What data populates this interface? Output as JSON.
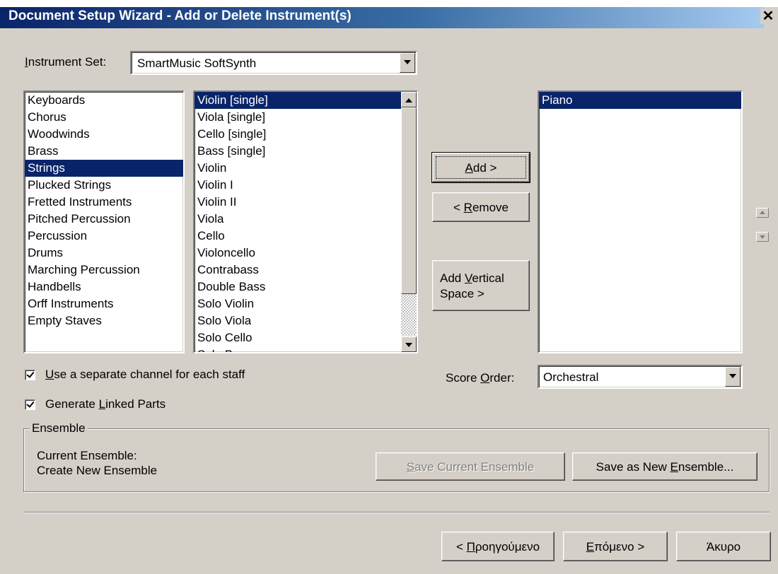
{
  "window": {
    "title": "Document Setup Wizard - Add or Delete Instrument(s)",
    "close_glyph": "✕"
  },
  "instrument_set": {
    "label_u": "I",
    "label_rest": "nstrument Set:",
    "value": "SmartMusic SoftSynth"
  },
  "categories": {
    "selected_index": 4,
    "items": [
      "Keyboards",
      "Chorus",
      "Woodwinds",
      "Brass",
      "Strings",
      "Plucked Strings",
      "Fretted Instruments",
      "Pitched Percussion",
      "Percussion",
      "Drums",
      "Marching Percussion",
      "Handbells",
      "Orff Instruments",
      "Empty Staves"
    ]
  },
  "instruments": {
    "selected_index": 0,
    "items": [
      "Violin [single]",
      "Viola [single]",
      "Cello [single]",
      "Bass [single]",
      "Violin",
      "Violin I",
      "Violin II",
      "Viola",
      "Cello",
      "Violoncello",
      "Contrabass",
      "Double Bass",
      "Solo Violin",
      "Solo Viola",
      "Solo Cello",
      "Solo Bass"
    ]
  },
  "buttons": {
    "add": {
      "u": "A",
      "rest": "dd >"
    },
    "remove": {
      "pre": "< ",
      "u": "R",
      "rest": "emove"
    },
    "add_vertical_line1": "Add ",
    "add_vertical_u": "V",
    "add_vertical_rest1": "ertical",
    "add_vertical_line2": "Space >",
    "save_current": {
      "u": "S",
      "rest": "ave Current Ensemble"
    },
    "save_new": {
      "pre": "Save as New ",
      "u": "E",
      "rest": "nsemble..."
    },
    "back": {
      "pre": "< ",
      "u": "Π",
      "rest": "ροηγούμενο"
    },
    "next": {
      "u": "Ε",
      "rest": "πόμενο >"
    },
    "cancel": "Άκυρο"
  },
  "score_list": {
    "selected_index": 0,
    "items": [
      "Piano"
    ]
  },
  "score_order": {
    "label_pre": "Score ",
    "label_u": "O",
    "label_rest": "rder:",
    "value": "Orchestral"
  },
  "options": {
    "separate_channel": {
      "checked": true,
      "u": "U",
      "rest": "se a separate channel for each staff"
    },
    "linked_parts": {
      "checked": true,
      "pre": "Generate ",
      "u": "L",
      "rest": "inked Parts"
    }
  },
  "ensemble": {
    "group_label": "Ensemble",
    "current_label": "Current Ensemble:",
    "current_value": "Create New Ensemble"
  }
}
